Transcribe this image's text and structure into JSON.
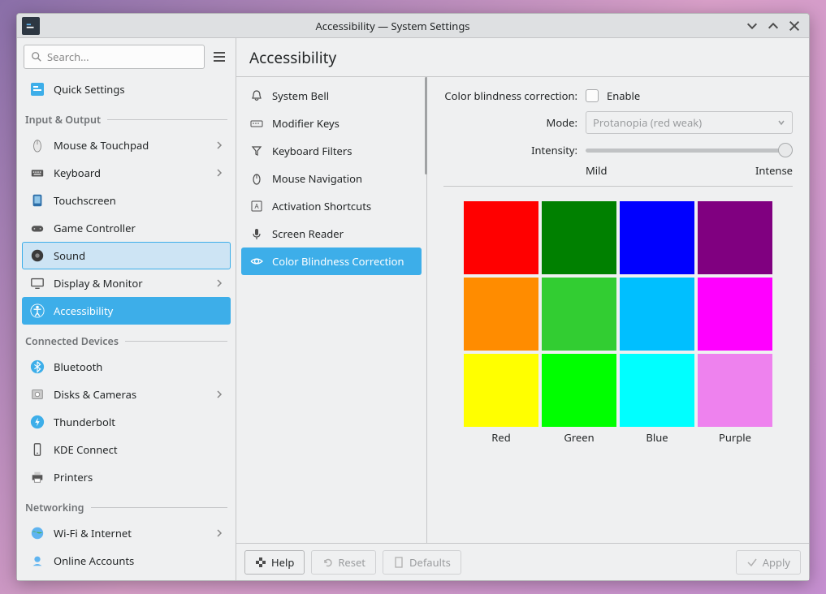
{
  "window": {
    "title": "Accessibility — System Settings"
  },
  "search": {
    "placeholder": "Search..."
  },
  "sidebar": {
    "top_item": "Quick Settings",
    "sections": [
      {
        "label": "Input & Output",
        "items": [
          {
            "label": "Mouse & Touchpad",
            "chevron": true
          },
          {
            "label": "Keyboard",
            "chevron": true
          },
          {
            "label": "Touchscreen"
          },
          {
            "label": "Game Controller"
          },
          {
            "label": "Sound",
            "focused": true
          },
          {
            "label": "Display & Monitor",
            "chevron": true
          },
          {
            "label": "Accessibility",
            "selected": true
          }
        ]
      },
      {
        "label": "Connected Devices",
        "items": [
          {
            "label": "Bluetooth"
          },
          {
            "label": "Disks & Cameras",
            "chevron": true
          },
          {
            "label": "Thunderbolt"
          },
          {
            "label": "KDE Connect"
          },
          {
            "label": "Printers"
          }
        ]
      },
      {
        "label": "Networking",
        "items": [
          {
            "label": "Wi-Fi & Internet",
            "chevron": true
          },
          {
            "label": "Online Accounts"
          }
        ]
      }
    ]
  },
  "page": {
    "title": "Accessibility"
  },
  "subnav": [
    {
      "label": "System Bell"
    },
    {
      "label": "Modifier Keys"
    },
    {
      "label": "Keyboard Filters"
    },
    {
      "label": "Mouse Navigation"
    },
    {
      "label": "Activation Shortcuts"
    },
    {
      "label": "Screen Reader"
    },
    {
      "label": "Color Blindness Correction",
      "selected": true
    }
  ],
  "form": {
    "correction_label": "Color blindness correction:",
    "enable_label": "Enable",
    "mode_label": "Mode:",
    "mode_value": "Protanopia (red weak)",
    "intensity_label": "Intensity:",
    "mild": "Mild",
    "intense": "Intense"
  },
  "swatches": {
    "colors": [
      "#ff0000",
      "#008000",
      "#0000ff",
      "#800080",
      "#ff8c00",
      "#32cd32",
      "#00bfff",
      "#ff00ff",
      "#ffff00",
      "#00ff00",
      "#00ffff",
      "#ee82ee"
    ],
    "labels": [
      "Red",
      "Green",
      "Blue",
      "Purple"
    ]
  },
  "footer": {
    "help": "Help",
    "reset": "Reset",
    "defaults": "Defaults",
    "apply": "Apply"
  }
}
